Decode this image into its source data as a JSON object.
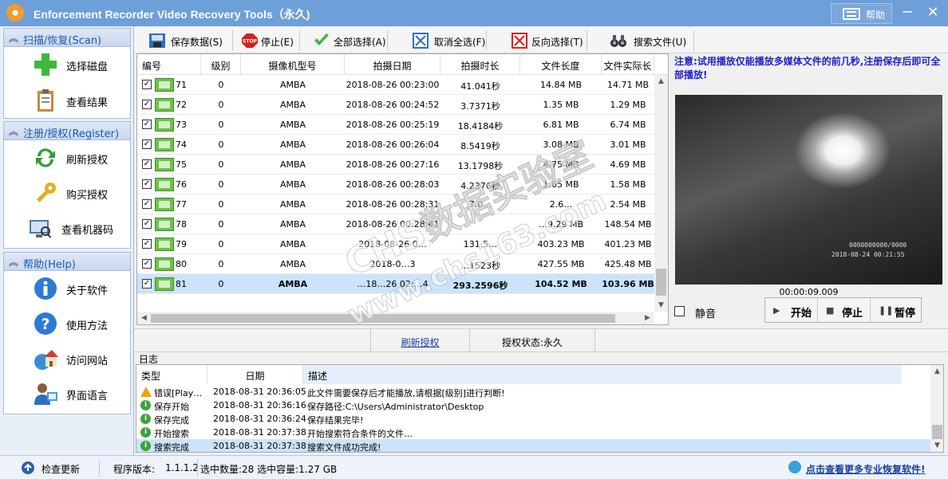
{
  "window": {
    "title": "Enforcement Recorder Video Recovery Tools（永久)",
    "help_label": "帮助",
    "minimize_glyph": "─",
    "close_glyph": "✕"
  },
  "sidebar": {
    "sections": [
      {
        "title": "扫描/恢复(Scan)",
        "items": [
          {
            "label": "选择磁盘",
            "icon": "plus-icon"
          },
          {
            "label": "查看结果",
            "icon": "clipboard-icon"
          }
        ]
      },
      {
        "title": "注册/授权(Register)",
        "items": [
          {
            "label": "刷新授权",
            "icon": "refresh-icon"
          },
          {
            "label": "购买授权",
            "icon": "key-icon"
          },
          {
            "label": "查看机器码",
            "icon": "computer-search-icon"
          }
        ]
      },
      {
        "title": "帮助(Help)",
        "items": [
          {
            "label": "关于软件",
            "icon": "info-icon"
          },
          {
            "label": "使用方法",
            "icon": "question-icon"
          },
          {
            "label": "访问网站",
            "icon": "home-globe-icon"
          },
          {
            "label": "界面语言",
            "icon": "user-language-icon"
          }
        ]
      }
    ],
    "chevron_glyph": "︽"
  },
  "toolbar": {
    "buttons": [
      {
        "label": "保存数据(S)",
        "icon": "save-data-icon"
      },
      {
        "label": "停止(E)",
        "icon": "stop-icon"
      },
      {
        "label": "全部选择(A)",
        "icon": "check-icon"
      },
      {
        "label": "取消全选(F)",
        "icon": "unselect-icon"
      },
      {
        "label": "反向选择(T)",
        "icon": "invert-icon"
      },
      {
        "label": "搜索文件(U)",
        "icon": "binoculars-icon"
      }
    ]
  },
  "table": {
    "columns": [
      "编号",
      "级别",
      "摄像机型号",
      "拍摄日期",
      "拍摄时长",
      "文件长度",
      "文件实际长"
    ],
    "rows": [
      {
        "id": "71",
        "level": "0",
        "model": "AMBA",
        "date": "2018-08-26 00:23:00",
        "duration": "41.041秒",
        "size": "14.84 MB",
        "actual": "14.71 MB",
        "selected": false
      },
      {
        "id": "72",
        "level": "0",
        "model": "AMBA",
        "date": "2018-08-26 00:24:52",
        "duration": "3.7371秒",
        "size": "1.35 MB",
        "actual": "1.29 MB",
        "selected": false
      },
      {
        "id": "73",
        "level": "0",
        "model": "AMBA",
        "date": "2018-08-26 00:25:19",
        "duration": "18.4184秒",
        "size": "6.81 MB",
        "actual": "6.74 MB",
        "selected": false
      },
      {
        "id": "74",
        "level": "0",
        "model": "AMBA",
        "date": "2018-08-26 00:26:04",
        "duration": "8.5419秒",
        "size": "3.08 MB",
        "actual": "3.01 MB",
        "selected": false
      },
      {
        "id": "75",
        "level": "0",
        "model": "AMBA",
        "date": "2018-08-26 00:27:16",
        "duration": "13.1798秒",
        "size": "4.75 MB",
        "actual": "4.69 MB",
        "selected": false
      },
      {
        "id": "76",
        "level": "0",
        "model": "AMBA",
        "date": "2018-08-26 00:28:03",
        "duration": "4.2376秒",
        "size": "1.65 MB",
        "actual": "1.58 MB",
        "selected": false
      },
      {
        "id": "77",
        "level": "0",
        "model": "AMBA",
        "date": "2018-08-26 00:28:31",
        "duration": "7.0…",
        "size": "2.6…",
        "actual": "2.54 MB",
        "selected": false
      },
      {
        "id": "78",
        "level": "0",
        "model": "AMBA",
        "date": "2018-08-26 00:28:41",
        "duration": "",
        "size": "…9.29 MB",
        "actual": "148.54 MB",
        "selected": false
      },
      {
        "id": "79",
        "level": "0",
        "model": "AMBA",
        "date": "2018-08-26 0…",
        "duration": "131.5…",
        "size": "403.23 MB",
        "actual": "401.23 MB",
        "selected": false
      },
      {
        "id": "80",
        "level": "0",
        "model": "AMBA",
        "date": "2018-0…3",
        "duration": "…1523秒",
        "size": "427.55 MB",
        "actual": "425.48 MB",
        "selected": false
      },
      {
        "id": "81",
        "level": "0",
        "model": "AMBA",
        "date": "…18…26 02:…4",
        "duration": "293.2596秒",
        "size": "104.52 MB",
        "actual": "103.96 MB",
        "selected": true
      }
    ],
    "check_glyph": "✓"
  },
  "preview": {
    "notice": "注意:试用播放仅能播放多媒体文件的前几秒,注册保存后即可全部播放!",
    "osd_line1": "0000000000/0000",
    "osd_line2": "2018-08-24 00:21:55",
    "timecode": "00:00:09.009",
    "mute_label": "静音",
    "buttons": [
      {
        "label": "开始",
        "glyph": "▶"
      },
      {
        "label": "停止",
        "glyph": "■"
      },
      {
        "label": "暂停",
        "glyph": "❚❚"
      }
    ]
  },
  "subbar": {
    "refresh_link": "刷新授权",
    "license_status": "授权状态:永久"
  },
  "log": {
    "title": "日志",
    "columns": [
      "类型",
      "日期",
      "描述"
    ],
    "rows": [
      {
        "type": "错误[Play…",
        "kind": "warn",
        "date": "2018-08-31 20:36:05",
        "desc": "此文件需要保存后才能播放,请根据[级别]进行判断!"
      },
      {
        "type": "保存开始",
        "kind": "info",
        "date": "2018-08-31 20:36:16",
        "desc": "保存路径:C:\\Users\\Administrator\\Desktop"
      },
      {
        "type": "保存完成",
        "kind": "info",
        "date": "2018-08-31 20:36:24",
        "desc": "保存结果完毕!"
      },
      {
        "type": "开始搜索",
        "kind": "info",
        "date": "2018-08-31 20:37:38",
        "desc": "开始搜索符合条件的文件…"
      },
      {
        "type": "搜索完成",
        "kind": "info",
        "date": "2018-08-31 20:37:38",
        "desc": "搜索文件成功完成!"
      }
    ],
    "info_glyph": "i"
  },
  "statusbar": {
    "check_update": "检查更新",
    "version_label": "程序版本:",
    "version": "1.1.1.2",
    "selection": "选中数量:28 选中容量:1.27 GB",
    "more_link": "点击查看更多专业恢复软件!"
  },
  "watermark": {
    "line1": "CHS数据实验室",
    "line2": "www.chs163.com"
  },
  "colors": {
    "titlebar": "#6d9fd8",
    "accent_blue": "#1a5ab8",
    "selected_row": "#cce4fb",
    "notice_text": "#2020cc"
  }
}
